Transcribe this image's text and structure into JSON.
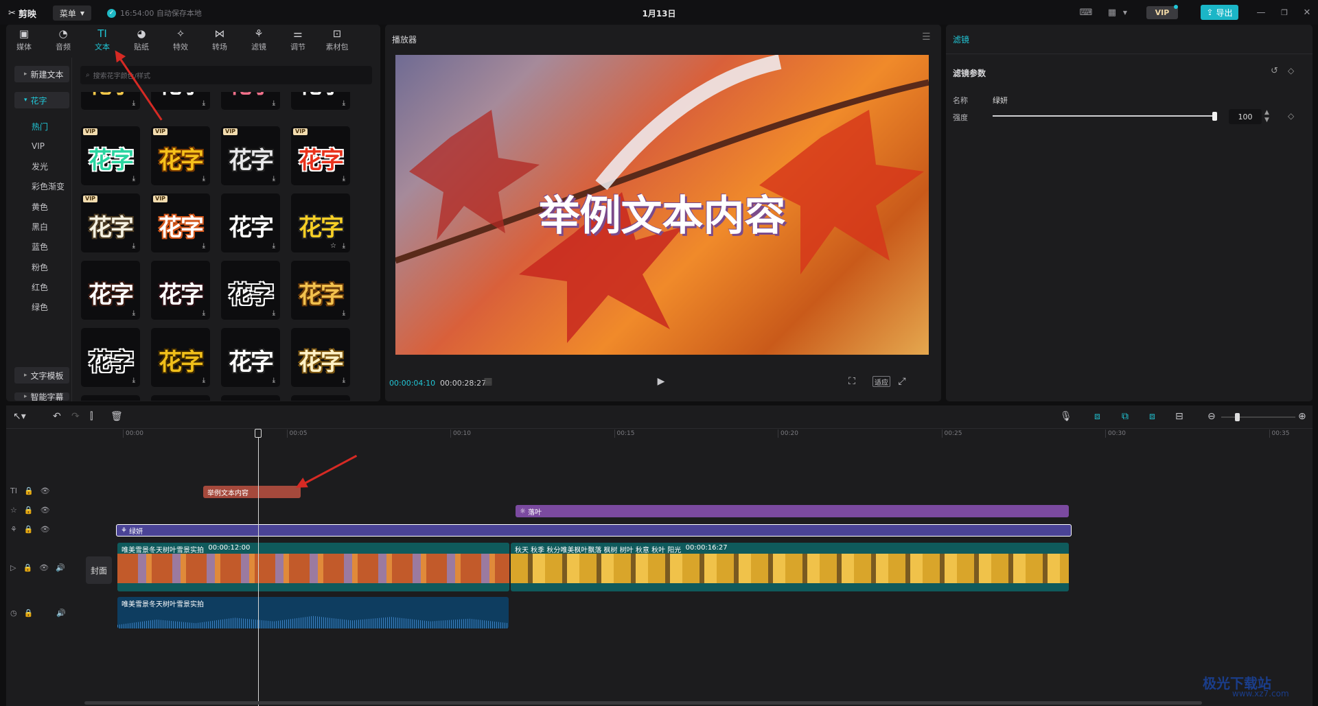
{
  "app": {
    "name": "剪映",
    "menu_label": "菜单",
    "autosave": "16:54:00 自动保存本地",
    "title": "1月13日",
    "vip_label": "VIP",
    "export_label": "导出"
  },
  "categories": [
    {
      "label": "媒体",
      "icon": "media-icon"
    },
    {
      "label": "音频",
      "icon": "audio-icon"
    },
    {
      "label": "文本",
      "icon": "text-icon",
      "active": true
    },
    {
      "label": "贴纸",
      "icon": "sticker-icon"
    },
    {
      "label": "特效",
      "icon": "effects-icon"
    },
    {
      "label": "转场",
      "icon": "transition-icon"
    },
    {
      "label": "滤镜",
      "icon": "filter-icon"
    },
    {
      "label": "调节",
      "icon": "adjust-icon"
    },
    {
      "label": "素材包",
      "icon": "package-icon"
    }
  ],
  "sidebar": {
    "new_text": "新建文本",
    "huazi": "花字",
    "subs": [
      "热门",
      "VIP",
      "发光",
      "彩色渐变",
      "黄色",
      "黑白",
      "蓝色",
      "粉色",
      "红色",
      "绿色"
    ],
    "template": "文字模板",
    "more": "智能字幕"
  },
  "search": {
    "placeholder": "搜索花字颜色/样式"
  },
  "tiles": {
    "label": "花字",
    "vip": "VIP"
  },
  "player": {
    "title": "播放器",
    "overlay_text": "举例文本内容",
    "current_time": "00:00:04:10",
    "total_time": "00:00:28:27",
    "fit_label": "适应"
  },
  "filter_panel": {
    "title": "滤镜",
    "section": "滤镜参数",
    "name_label": "名称",
    "name_value": "绿妍",
    "strength_label": "强度",
    "strength_value": "100",
    "strength_fraction": 1.0
  },
  "ruler": [
    "00:00",
    "00:05",
    "00:10",
    "00:15",
    "00:20",
    "00:25",
    "00:30",
    "00:35"
  ],
  "tracks": {
    "text_clip": "举例文本内容",
    "effect_clip": "落叶",
    "filter_clip": "绿妍",
    "cover": "封面",
    "video1_name": "唯美雪景冬天树叶雪景实拍",
    "video1_dur": "00:00:12:00",
    "video2_name": "秋天 秋季 秋分唯美枫叶飘落 枫树 树叶 秋意 秋叶 阳光",
    "video2_dur": "00:00:16:27",
    "audio_name": "唯美雪景冬天树叶雪景实拍"
  },
  "watermark": {
    "name": "极光下载站",
    "url": "www.xz7.com"
  }
}
